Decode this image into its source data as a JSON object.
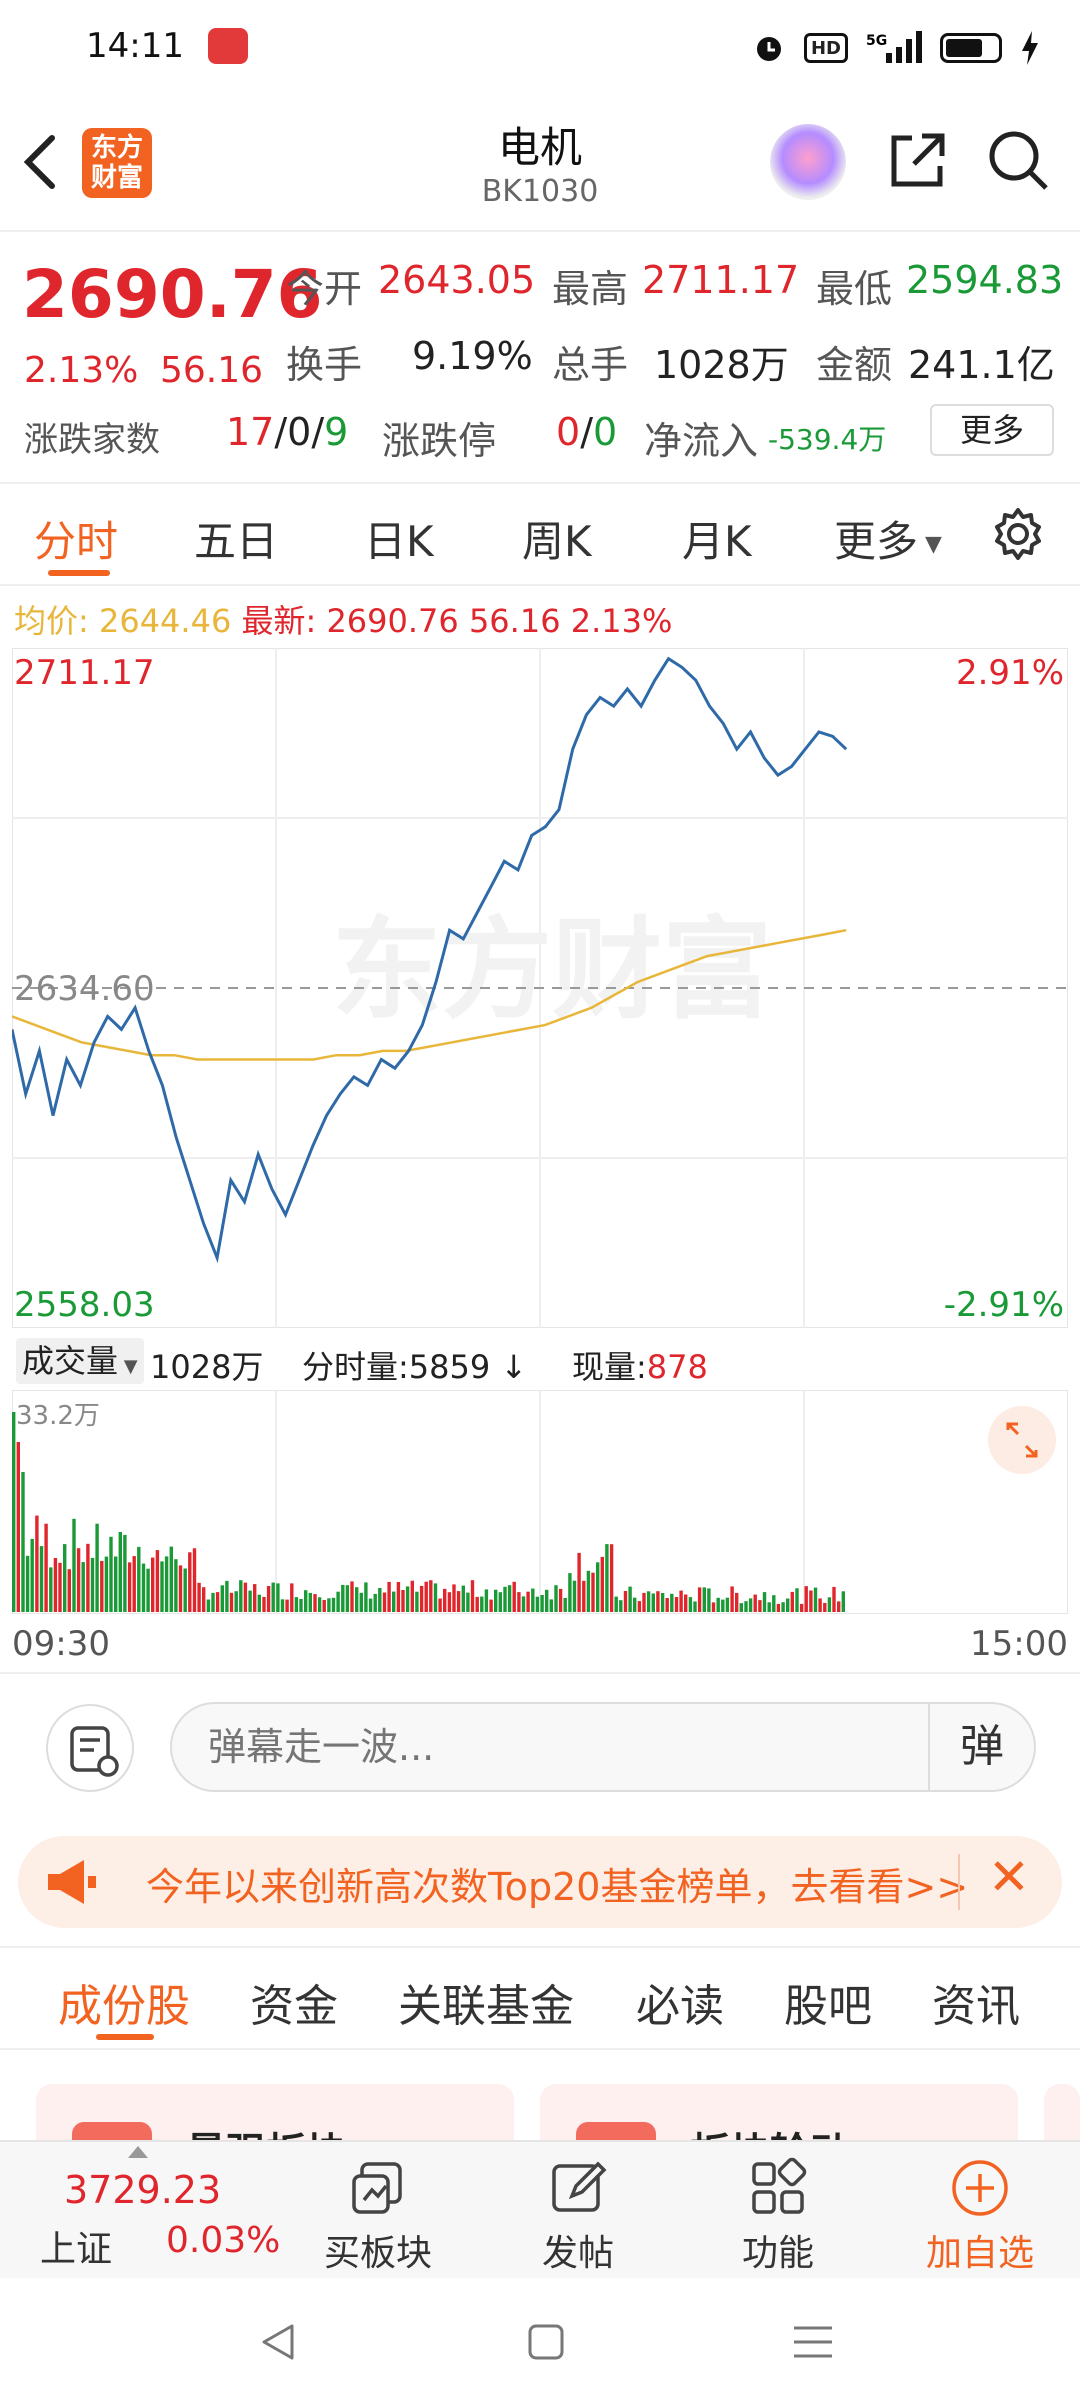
{
  "status": {
    "time": "14:11",
    "hd": "HD",
    "net": "5G"
  },
  "header": {
    "logo_line1": "东方",
    "logo_line2": "财富",
    "title": "电机",
    "code": "BK1030"
  },
  "quote": {
    "price": "2690.76",
    "change_pct": "2.13%",
    "change_val": "56.16",
    "open_label": "今开",
    "open": "2643.05",
    "high_label": "最高",
    "high": "2711.17",
    "low_label": "最低",
    "low": "2594.83",
    "turnover_label": "换手",
    "turnover": "9.19%",
    "volume_label": "总手",
    "volume": "1028万",
    "amount_label": "金额",
    "amount": "241.1亿",
    "breadth_label": "涨跌家数",
    "breadth_up": "17",
    "breadth_flat": "0",
    "breadth_down": "9",
    "limit_label": "涨跌停",
    "limit_up": "0",
    "limit_down": "0",
    "netflow_label": "净流入",
    "netflow": "-539.4万",
    "more": "更多",
    "sep": "/"
  },
  "tabs": [
    "分时",
    "五日",
    "日K",
    "周K",
    "月K",
    "更多"
  ],
  "intraday": {
    "avg_label": "均价:",
    "avg": "2644.46",
    "last_label": "最新:",
    "last": "2690.76",
    "last_chg": "56.16",
    "last_pct": "2.13%",
    "top_price": "2711.17",
    "top_pct": "2.91%",
    "base_price": "2634.60",
    "bottom_price": "2558.03",
    "bottom_pct": "-2.91%",
    "watermark": "东方财富"
  },
  "volume": {
    "select_label": "成交量",
    "total": "1028万",
    "tick_label": "分时量:",
    "tick_value": "5859",
    "tick_arrow": "↓",
    "now_label": "现量:",
    "now_value": "878",
    "max_label": "33.2万",
    "time_start": "09:30",
    "time_end": "15:00"
  },
  "danmu": {
    "placeholder": "弹幕走一波...",
    "button": "弹"
  },
  "banner": {
    "text": "今年以来创新高次数Top20基金榜单，去看看>>",
    "close": "✕"
  },
  "subtabs": [
    "成份股",
    "资金",
    "关联基金",
    "必读",
    "股吧",
    "资讯"
  ],
  "cards": [
    "最强板块",
    "板块轮动"
  ],
  "bottomnav": {
    "index_value": "3729.23",
    "index_name": "上证",
    "index_chg": "0.03%",
    "items": [
      "买板块",
      "发帖",
      "功能",
      "加自选"
    ]
  },
  "chart_data": {
    "type": "line",
    "title": "",
    "ylim": [
      2558.03,
      2711.17
    ],
    "base": 2634.6,
    "x_range": [
      "09:30",
      "15:00"
    ],
    "series": [
      {
        "name": "最新",
        "values": [
          2625,
          2610,
          2620,
          2605,
          2618,
          2612,
          2622,
          2628,
          2625,
          2630,
          2620,
          2612,
          2600,
          2590,
          2580,
          2572,
          2590,
          2585,
          2596,
          2588,
          2582,
          2590,
          2598,
          2605,
          2610,
          2614,
          2612,
          2618,
          2616,
          2620,
          2626,
          2636,
          2648,
          2646,
          2652,
          2658,
          2664,
          2662,
          2670,
          2672,
          2676,
          2690,
          2698,
          2702,
          2700,
          2704,
          2700,
          2706,
          2711,
          2709,
          2706,
          2700,
          2696,
          2690,
          2694,
          2688,
          2684,
          2686,
          2690,
          2694,
          2693,
          2690
        ]
      },
      {
        "name": "均价",
        "values": [
          2628,
          2626,
          2624,
          2622,
          2621,
          2620,
          2619,
          2619,
          2618,
          2618,
          2618,
          2618,
          2618,
          2618,
          2619,
          2619,
          2620,
          2620,
          2621,
          2622,
          2623,
          2624,
          2625,
          2626,
          2628,
          2630,
          2633,
          2636,
          2638,
          2640,
          2642,
          2643,
          2644,
          2645,
          2646,
          2647,
          2648
        ]
      }
    ],
    "volume_max": "33.2万"
  }
}
